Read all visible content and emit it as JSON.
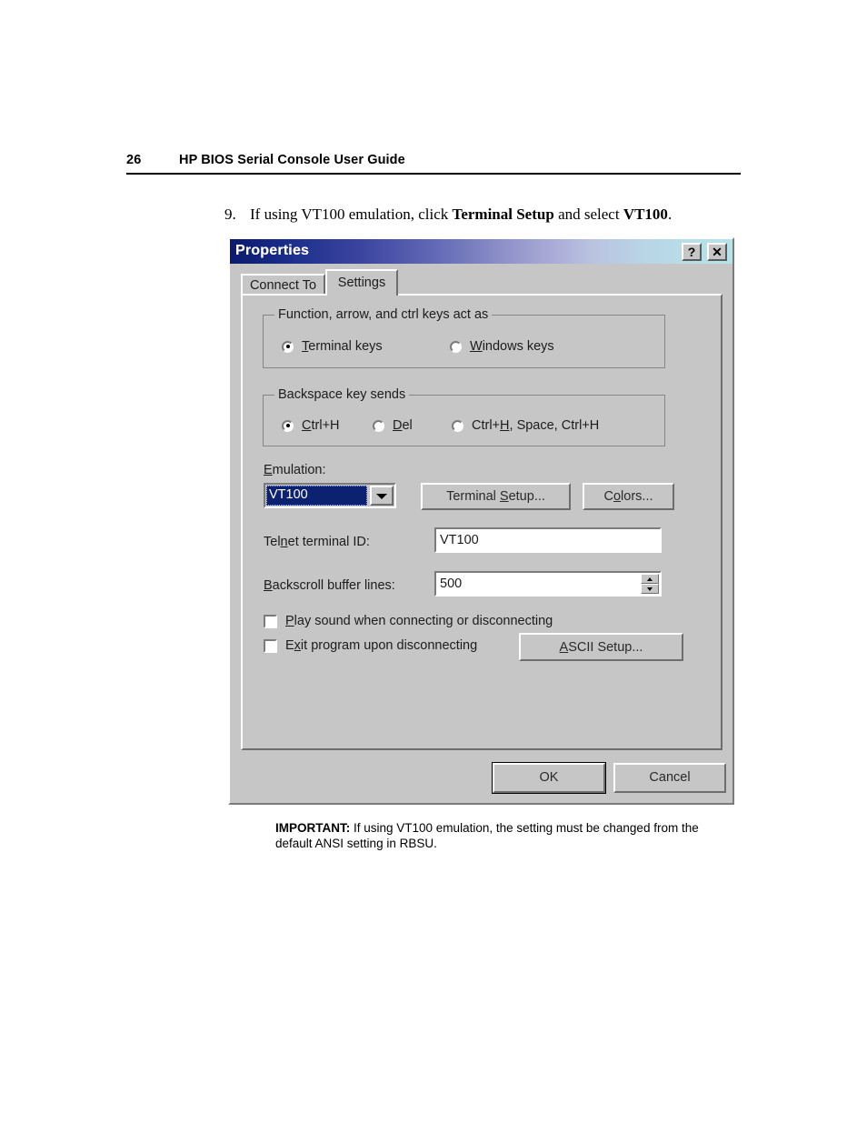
{
  "page": {
    "number": "26",
    "header_title": "HP BIOS Serial Console User Guide"
  },
  "step": {
    "number": "9.",
    "text_part1": "If using VT100 emulation, click ",
    "bold1": "Terminal Setup",
    "text_part2": " and select ",
    "bold2": "VT100",
    "text_part3": "."
  },
  "dialog": {
    "title": "Properties",
    "titlebar_buttons": {
      "help": "?",
      "close": "✕"
    },
    "tabs": [
      {
        "label": "Connect To",
        "active": false
      },
      {
        "label": "Settings",
        "active": true
      }
    ],
    "groups": {
      "function_keys": {
        "legend": "Function, arrow, and ctrl keys act as",
        "options": [
          {
            "label_pre": "",
            "accel": "T",
            "label_post": "erminal keys",
            "selected": true
          },
          {
            "label_pre": "",
            "accel": "W",
            "label_post": "indows keys",
            "selected": false
          }
        ]
      },
      "backspace": {
        "legend": "Backspace key sends",
        "options": [
          {
            "label_pre": "",
            "accel": "C",
            "label_post": "trl+H",
            "selected": true
          },
          {
            "label_pre": "",
            "accel": "D",
            "label_post": "el",
            "selected": false
          },
          {
            "label_pre": "Ctrl+",
            "accel": "H",
            "label_post": ", Space, Ctrl+H",
            "selected": false
          }
        ]
      }
    },
    "emulation": {
      "label_pre": "",
      "label_accel": "E",
      "label_post": "mulation:",
      "selected_value": "VT100"
    },
    "buttons": {
      "terminal_setup_pre": "Terminal ",
      "terminal_setup_accel": "S",
      "terminal_setup_post": "etup...",
      "colors_pre": "C",
      "colors_accel": "o",
      "colors_post": "lors...",
      "ascii_setup_accel": "A",
      "ascii_setup_post": "SCII Setup...",
      "ok": "OK",
      "cancel": "Cancel"
    },
    "fields": {
      "telnet_id": {
        "label_pre": "Tel",
        "label_accel": "n",
        "label_post": "et terminal ID:",
        "value": "VT100"
      },
      "backscroll": {
        "label_accel": "B",
        "label_post": "ackscroll buffer lines:",
        "value": "500"
      }
    },
    "checkboxes": [
      {
        "accel": "P",
        "label_pre": "",
        "label_post": "lay sound when connecting or disconnecting",
        "checked": false
      },
      {
        "accel": "x",
        "label_pre": "E",
        "label_post": "it program upon disconnecting",
        "checked": false
      }
    ]
  },
  "note": {
    "label": "IMPORTANT:",
    "text": " If using VT100 emulation, the setting must be changed from the default ANSI setting in RBSU."
  }
}
